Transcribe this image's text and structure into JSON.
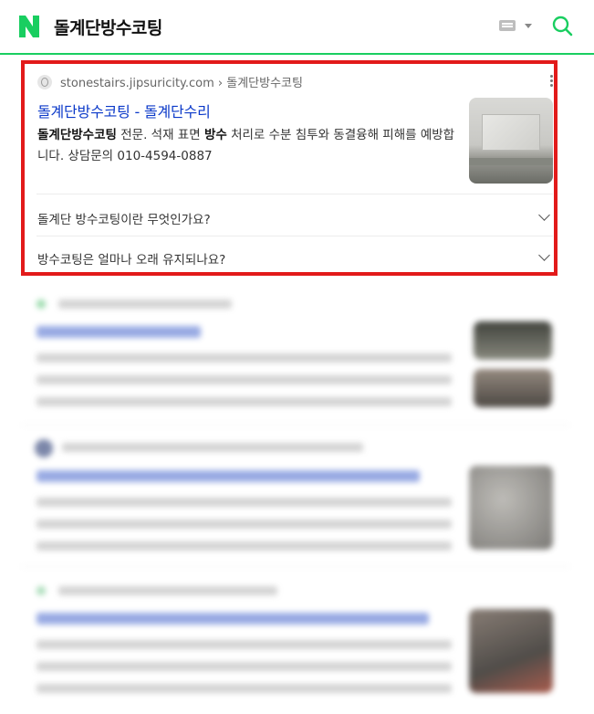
{
  "search": {
    "query": "돌계단방수코팅"
  },
  "result": {
    "source": "stonestairs.jipsuricity.com › 돌계단방수코팅",
    "title": "돌계단방수코팅 - 돌계단수리",
    "desc_bold1": "돌계단방수코팅",
    "desc_text1": " 전문. 석재 표면 ",
    "desc_bold2": "방수",
    "desc_text2": " 처리로 수분 침투와 동결융해 피해를 예방합니다. 상담문의 010-4594-0887",
    "faqs": [
      {
        "q": "돌계단 방수코팅이란 무엇인가요?"
      },
      {
        "q": "방수코팅은 얼마나 오래 유지되나요?"
      }
    ]
  },
  "colors": {
    "brand": "#19ce60",
    "link": "#0b39c9",
    "highlight": "#e21a1a"
  }
}
